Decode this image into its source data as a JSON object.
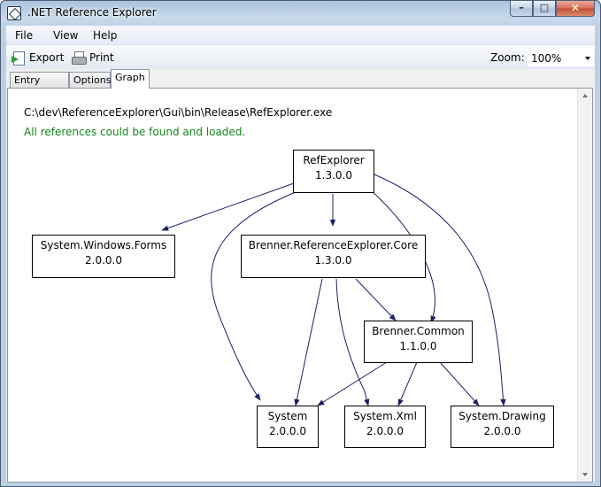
{
  "window": {
    "title": ".NET Reference Explorer",
    "buttons": {
      "minimize": "–",
      "maximize": "□",
      "close": "✕"
    }
  },
  "menu": [
    {
      "label": "File"
    },
    {
      "label": "View"
    },
    {
      "label": "Help"
    }
  ],
  "toolbar": {
    "export_label": "Export",
    "print_label": "Print",
    "zoom_label": "Zoom:",
    "zoom_value": "100%"
  },
  "tabs": [
    {
      "label": "Entry Points"
    },
    {
      "label": "Options"
    },
    {
      "label": "Graph",
      "active": true
    }
  ],
  "graph_panel": {
    "path": "C:\\dev\\ReferenceExplorer\\Gui\\bin\\Release\\RefExplorer.exe",
    "status": "All references could be found and loaded.",
    "status_color": "#14871a",
    "edge_color": "#1b1f66",
    "nodes": {
      "refexplorer": {
        "name": "RefExplorer",
        "version": "1.3.0.0"
      },
      "winforms": {
        "name": "System.Windows.Forms",
        "version": "2.0.0.0"
      },
      "core": {
        "name": "Brenner.ReferenceExplorer.Core",
        "version": "1.3.0.0"
      },
      "common": {
        "name": "Brenner.Common",
        "version": "1.1.0.0"
      },
      "system": {
        "name": "System",
        "version": "2.0.0.0"
      },
      "xml": {
        "name": "System.Xml",
        "version": "2.0.0.0"
      },
      "drawing": {
        "name": "System.Drawing",
        "version": "2.0.0.0"
      }
    }
  }
}
